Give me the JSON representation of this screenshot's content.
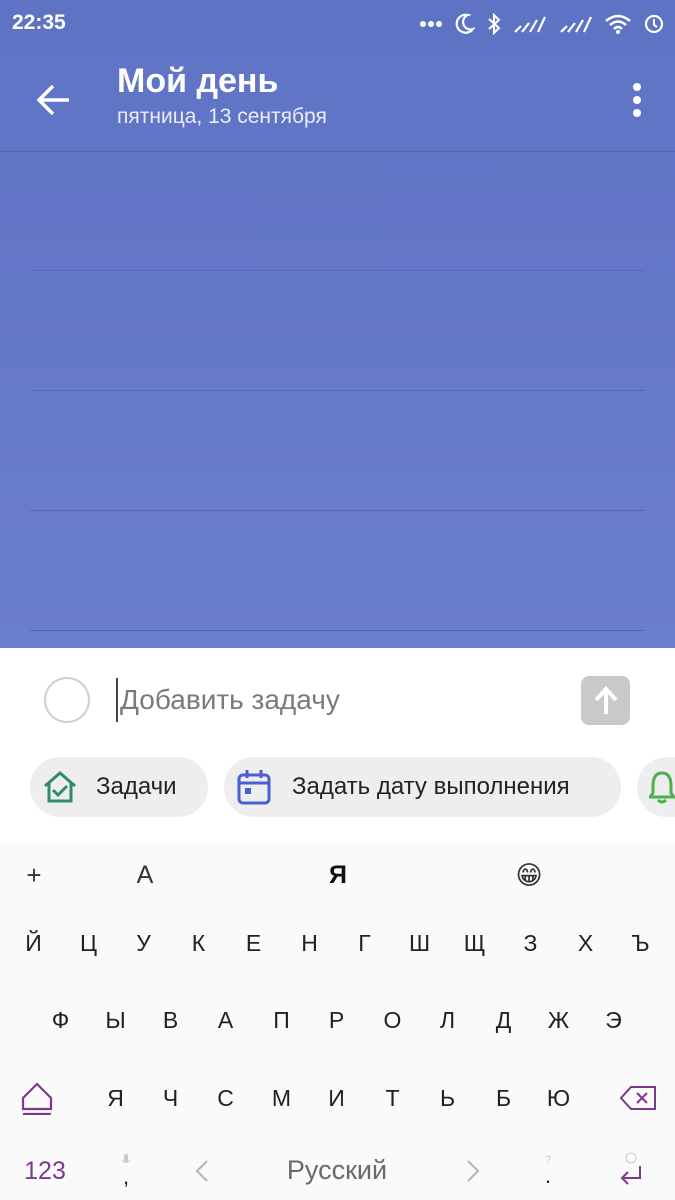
{
  "status_bar": {
    "time": "22:35",
    "icons": [
      "more-dots-icon",
      "moon-icon",
      "bluetooth-icon",
      "signal-icon",
      "signal-icon",
      "wifi-icon",
      "sync-icon"
    ]
  },
  "app_bar": {
    "title": "Мой день",
    "subtitle": "пятница, 13 сентября",
    "back_icon": "arrow-left-icon",
    "more_icon": "more-vertical-icon"
  },
  "task_input": {
    "placeholder": "Добавить задачу",
    "value": ""
  },
  "chips": [
    {
      "label": "Задачи",
      "icon": "home-check-icon"
    },
    {
      "label": "Задать дату выполнения",
      "icon": "calendar-icon"
    },
    {
      "label": "",
      "icon": "bell-icon"
    }
  ],
  "keyboard": {
    "toolbar": [
      "+",
      "A",
      "Я",
      "😁"
    ],
    "row1": [
      "Й",
      "Ц",
      "У",
      "К",
      "Е",
      "Н",
      "Г",
      "Ш",
      "Щ",
      "З",
      "Х",
      "Ъ"
    ],
    "row2": [
      "Ф",
      "Ы",
      "В",
      "А",
      "П",
      "Р",
      "О",
      "Л",
      "Д",
      "Ж",
      "Э"
    ],
    "row3": [
      "Я",
      "Ч",
      "С",
      "М",
      "И",
      "Т",
      "Ь",
      "Б",
      "Ю"
    ],
    "numbers_label": "123",
    "comma": ",",
    "space_label": "Русский",
    "period": "."
  },
  "colors": {
    "accent": "#6175c6",
    "chip_green": "#2e8b6f",
    "chip_blue": "#4a5fd1",
    "bell_green": "#4caf50",
    "shift_purple": "#7b3a8e"
  }
}
